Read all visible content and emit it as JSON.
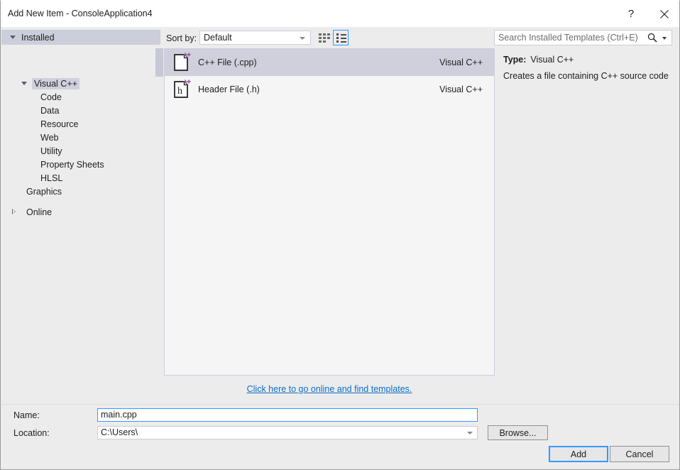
{
  "window": {
    "title": "Add New Item - ConsoleApplication4",
    "help_icon": "question-mark-icon",
    "help_label": "?",
    "close_label": "✕"
  },
  "sidebar": {
    "installed_header": "Installed",
    "nodes": [
      {
        "label": "Visual C++",
        "level": 1,
        "expander": "down",
        "selected": true
      },
      {
        "label": "Code",
        "level": 2,
        "expander": "none",
        "selected": false
      },
      {
        "label": "Data",
        "level": 2,
        "expander": "none",
        "selected": false
      },
      {
        "label": "Resource",
        "level": 2,
        "expander": "none",
        "selected": false
      },
      {
        "label": "Web",
        "level": 2,
        "expander": "none",
        "selected": false
      },
      {
        "label": "Utility",
        "level": 2,
        "expander": "none",
        "selected": false
      },
      {
        "label": "Property Sheets",
        "level": 2,
        "expander": "none",
        "selected": false
      },
      {
        "label": "HLSL",
        "level": 2,
        "expander": "none",
        "selected": false
      },
      {
        "label": "Graphics",
        "level": 1,
        "expander": "none",
        "selected": false
      },
      {
        "label": "Online",
        "level": 1,
        "expander": "right",
        "selected": false
      }
    ]
  },
  "toolbar": {
    "sort_by_label": "Sort by:",
    "sort_by_value": "Default",
    "view_tiles_icon": "tile-view-icon",
    "view_list_icon": "list-view-icon"
  },
  "search": {
    "placeholder": "Search Installed Templates (Ctrl+E)",
    "icon": "magnifier-icon",
    "dropdown_icon": "chevron-down-icon"
  },
  "templates": {
    "items": [
      {
        "name": "C++ File (.cpp)",
        "origin": "Visual C++",
        "icon": "cpp-file-icon",
        "glyph": "",
        "badge": "++",
        "selected": true
      },
      {
        "name": "Header File (.h)",
        "origin": "Visual C++",
        "icon": "header-file-icon",
        "glyph": "h",
        "badge": "++",
        "selected": false
      }
    ],
    "online_link": "Click here to go online and find templates."
  },
  "details": {
    "type_label": "Type:",
    "type_value": "Visual C++",
    "description": "Creates a file containing C++ source code"
  },
  "fields": {
    "name_label": "Name:",
    "name_value": "main.cpp",
    "location_label": "Location:",
    "location_value": "C:\\Users\\",
    "location_dropdown_icon": "chevron-down-icon"
  },
  "buttons": {
    "browse": "Browse...",
    "add": "Add",
    "cancel": "Cancel"
  },
  "colors": {
    "dialog_bg": "#ececed",
    "selection": "#cfd0dc",
    "header_band": "#cccedb",
    "accent_focus": "#3399ff",
    "link": "#0b6fc7",
    "badge_purple": "#9b4f96"
  }
}
